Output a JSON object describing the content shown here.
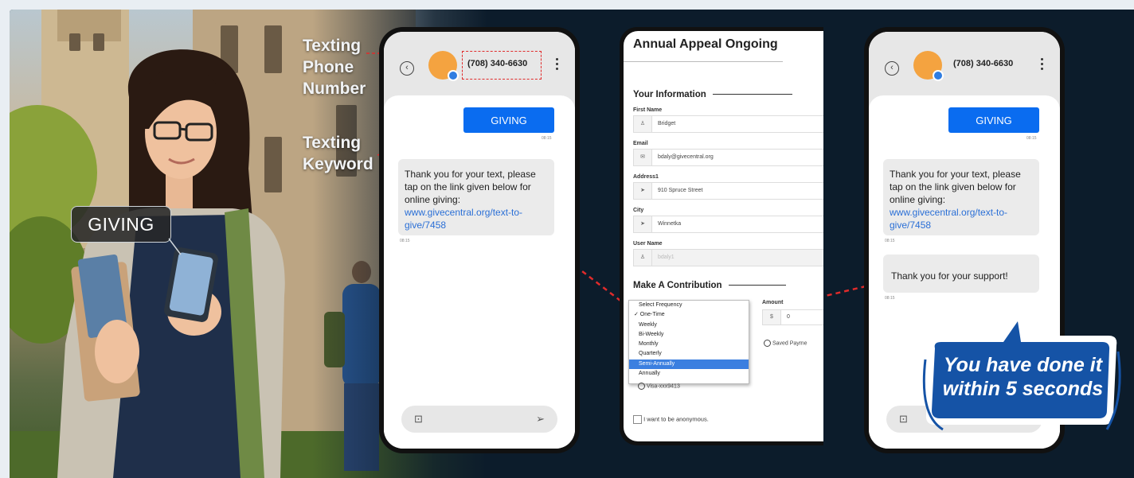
{
  "callouts": {
    "phone_number_label": [
      "Texting",
      "Phone",
      "Number"
    ],
    "keyword_label": [
      "Texting",
      "Keyword"
    ],
    "keyword_bubble": "GIVING"
  },
  "phone1": {
    "phone_number": "(708) 340-6630",
    "outgoing": "GIVING",
    "outgoing_time": "08:15",
    "reply_lines": [
      "Thank you for your text, please",
      "tap on the link given below for",
      "online giving:"
    ],
    "reply_link": "www.givecentral.org/text-to-give/7458",
    "reply_time": "08:15"
  },
  "form": {
    "title": "Annual Appeal Ongoing",
    "section_info": "Your Information",
    "fields": [
      {
        "label": "First Name",
        "icon": "user-icon",
        "glyph": "♙",
        "value": "Bridget"
      },
      {
        "label": "Email",
        "icon": "mail-icon",
        "glyph": "✉",
        "value": "bdaly@givecentral.org"
      },
      {
        "label": "Address1",
        "icon": "location-icon",
        "glyph": "➤",
        "value": "910 Spruce Street"
      },
      {
        "label": "City",
        "icon": "location-icon",
        "glyph": "➤",
        "value": "Winnetka"
      },
      {
        "label": "User Name",
        "icon": "user-icon",
        "glyph": "♙",
        "value": "bdaly1"
      }
    ],
    "section_contribution": "Make A Contribution",
    "frequency_options": [
      "Select Frequency",
      "✓ One-Time",
      "Weekly",
      "Bi-Weekly",
      "Monthly",
      "Quarterly",
      "Semi-Annually",
      "Annually"
    ],
    "amount_label": "Amount",
    "currency": "$",
    "amount_value": "0",
    "saved_payment": "Saved Payme",
    "card": "Visa-xxx9413",
    "anonymous": "I want to be anonymous."
  },
  "phone3": {
    "phone_number": "(708) 340-6630",
    "outgoing": "GIVING",
    "outgoing_time": "08:15",
    "reply_lines": [
      "Thank you for your text, please",
      "tap on the link given below for",
      "online giving:"
    ],
    "reply_link": "www.givecentral.org/text-to-give/7458",
    "reply_time": "08:15",
    "thanks": "Thank you for your support!",
    "thanks_time": "08:15"
  },
  "badge": {
    "line1": "You have done it",
    "line2": "within 5 seconds"
  },
  "colors": {
    "background": "#0c1c2b",
    "accent_blue": "#0a6cf0",
    "dashed_line": "#e02b2b",
    "avatar": "#f4a340",
    "badge_blue": "#1553a6"
  }
}
